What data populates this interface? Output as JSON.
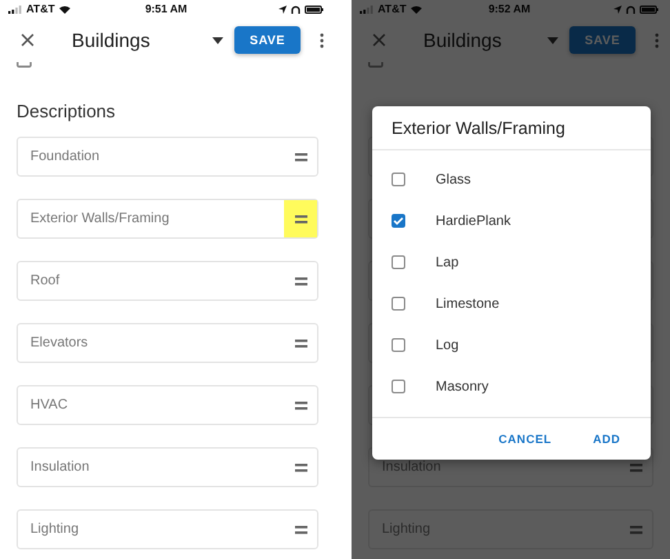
{
  "screens": [
    {
      "status": {
        "carrier": "AT&T",
        "time": "9:51 AM"
      },
      "header": {
        "title": "Buildings",
        "save": "SAVE"
      },
      "section_title": "Descriptions",
      "fields": [
        {
          "label": "Foundation",
          "highlighted": false
        },
        {
          "label": "Exterior Walls/Framing",
          "highlighted": true
        },
        {
          "label": "Roof",
          "highlighted": false
        },
        {
          "label": "Elevators",
          "highlighted": false
        },
        {
          "label": "HVAC",
          "highlighted": false
        },
        {
          "label": "Insulation",
          "highlighted": false
        },
        {
          "label": "Lighting",
          "highlighted": false
        }
      ]
    },
    {
      "status": {
        "carrier": "AT&T",
        "time": "9:52 AM"
      },
      "header": {
        "title": "Buildings",
        "save": "SAVE"
      },
      "fields": [
        {
          "label": "Insulation",
          "highlighted": false
        },
        {
          "label": "Lighting",
          "highlighted": false
        }
      ],
      "dialog": {
        "title": "Exterior Walls/Framing",
        "options": [
          {
            "label": "Glass",
            "checked": false
          },
          {
            "label": "HardiePlank",
            "checked": true
          },
          {
            "label": "Lap",
            "checked": false
          },
          {
            "label": "Limestone",
            "checked": false
          },
          {
            "label": "Log",
            "checked": false
          },
          {
            "label": "Masonry",
            "checked": false
          }
        ],
        "buttons": [
          "CANCEL",
          "ADD"
        ]
      }
    }
  ]
}
